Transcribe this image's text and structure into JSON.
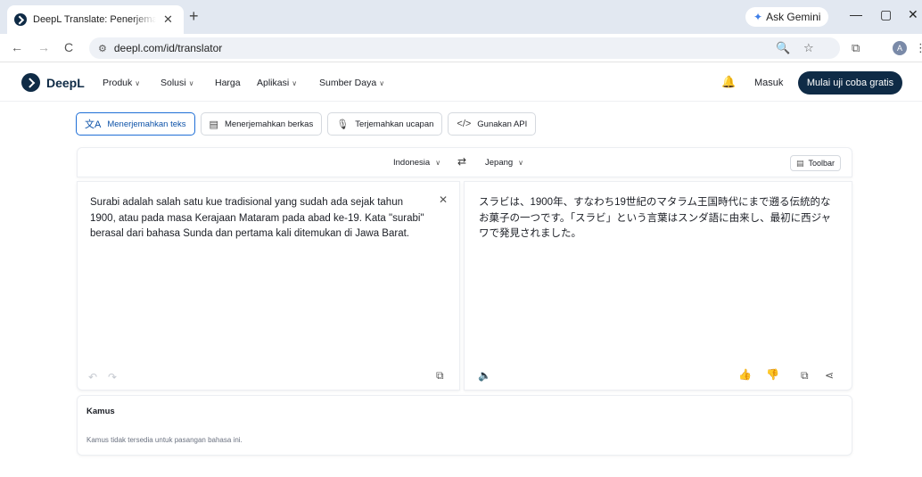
{
  "browser": {
    "tab_title": "DeepL Translate: Penerjemah paling akurat di dunia",
    "tab_close": "✕",
    "new_tab": "+",
    "gemini_label": "Ask Gemini",
    "minimize": "—",
    "restore": "▢",
    "close": "✕",
    "back": "←",
    "forward": "→",
    "reload": "C",
    "url": "deepl.com/id/translator",
    "site_info": "⚙",
    "zoom": "🔍",
    "bookmark": "☆",
    "reading": "⧉",
    "menu": "⋮",
    "profile_initial": "A"
  },
  "nav": {
    "brand": "DeepL",
    "items": [
      {
        "label": "Produk",
        "chev": "∨"
      },
      {
        "label": "Solusi",
        "chev": "∨"
      },
      {
        "label": "Harga"
      },
      {
        "label": "Aplikasi",
        "chev": "∨"
      },
      {
        "label": "Sumber Daya",
        "chev": "∨"
      }
    ],
    "bell": "🔔",
    "login": "Masuk",
    "cta": "Mulai uji coba gratis"
  },
  "modes": [
    {
      "icon": "文A",
      "label": "Menerjemahkan teks",
      "active": true
    },
    {
      "icon": "▤",
      "label": "Menerjemahkan berkas"
    },
    {
      "icon": "🎙",
      "label": "Terjemahkan ucapan"
    },
    {
      "icon": "</>",
      "label": "Gunakan API"
    }
  ],
  "translator": {
    "source_lang": "Indonesia",
    "target_lang": "Jepang",
    "chev": "∨",
    "swap": "⇄",
    "toolbar_icon": "▤",
    "toolbar_label": "Toolbar",
    "source_text": "Surabi adalah salah satu kue tradisional yang sudah ada sejak tahun 1900, atau pada masa Kerajaan Mataram pada abad ke-19. Kata \"surabi\" berasal dari bahasa Sunda dan pertama kali ditemukan di Jawa Barat.",
    "target_text": "スラビは、1900年、すなわち19世紀のマタラム王国時代にまで遡る伝統的なお菓子の一つです。「スラビ」という言葉はスンダ語に由来し、最初に西ジャワで発見されました。",
    "clear": "✕",
    "undo": "↶",
    "redo": "↷",
    "copy_source": "⧉",
    "speak": "🔈",
    "thumbs_up": "👍",
    "thumbs_down": "👎",
    "copy_target": "⧉",
    "share": "⋖"
  },
  "dictionary": {
    "title": "Kamus",
    "note": "Kamus tidak tersedia untuk pasangan bahasa ini."
  }
}
